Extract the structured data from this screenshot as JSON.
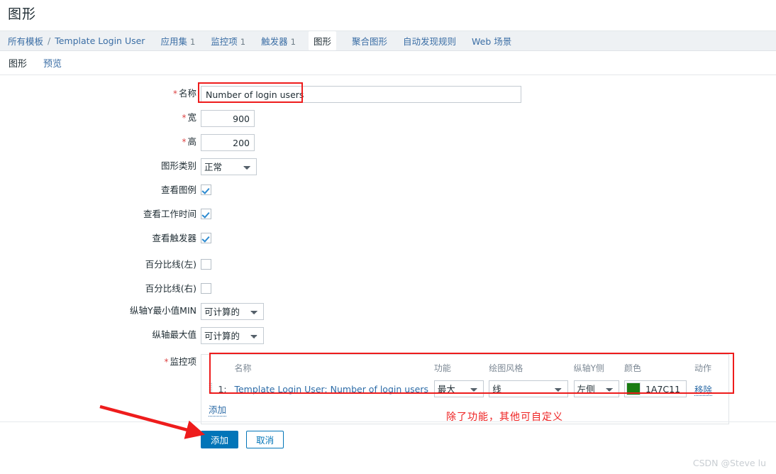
{
  "page": {
    "title": "图形",
    "watermark": "CSDN @Steve lu"
  },
  "breadcrumb": {
    "root": "所有模板",
    "separator": "/",
    "template": "Template Login User",
    "items": [
      {
        "label": "应用集",
        "count": "1",
        "selected": false
      },
      {
        "label": "监控项",
        "count": "1",
        "selected": false
      },
      {
        "label": "触发器",
        "count": "1",
        "selected": false
      },
      {
        "label": "图形",
        "count": "",
        "selected": true
      },
      {
        "label": "聚合图形",
        "count": "",
        "selected": false
      },
      {
        "label": "自动发现规则",
        "count": "",
        "selected": false
      },
      {
        "label": "Web 场景",
        "count": "",
        "selected": false
      }
    ]
  },
  "subtabs": [
    {
      "label": "图形",
      "active": true
    },
    {
      "label": "预览",
      "active": false
    }
  ],
  "form": {
    "name": {
      "label": "名称",
      "required": true,
      "value": "Number of login users"
    },
    "width": {
      "label": "宽",
      "required": true,
      "value": "900"
    },
    "height": {
      "label": "高",
      "required": true,
      "value": "200"
    },
    "graph_type": {
      "label": "图形类别",
      "required": false,
      "value": "正常"
    },
    "show_legend": {
      "label": "查看图例",
      "checked": true
    },
    "show_working_time": {
      "label": "查看工作时间",
      "checked": true
    },
    "show_triggers": {
      "label": "查看触发器",
      "checked": true
    },
    "percentile_left": {
      "label": "百分比线(左)",
      "checked": false
    },
    "percentile_right": {
      "label": "百分比线(右)",
      "checked": false
    },
    "y_min": {
      "label": "纵轴Y最小值MIN",
      "value": "可计算的"
    },
    "y_max": {
      "label": "纵轴最大值",
      "value": "可计算的"
    },
    "items": {
      "label": "监控项",
      "required": true
    }
  },
  "items_table": {
    "headers": {
      "name": "名称",
      "function": "功能",
      "draw_style": "绘图风格",
      "y_side": "纵轴Y侧",
      "color": "颜色",
      "action": "动作"
    },
    "rows": [
      {
        "index": "1:",
        "name": "Template Login User: Number of login users",
        "function": "最大",
        "draw_style": "线",
        "y_side": "左侧",
        "color_hex": "1A7C11",
        "color_swatch": "#1A7C11",
        "action": "移除"
      }
    ],
    "add_label": "添加"
  },
  "footer": {
    "submit": "添加",
    "cancel": "取消"
  },
  "annotations": {
    "note": "除了功能，其他可自定义",
    "accent_color": "#ee1c1c"
  }
}
